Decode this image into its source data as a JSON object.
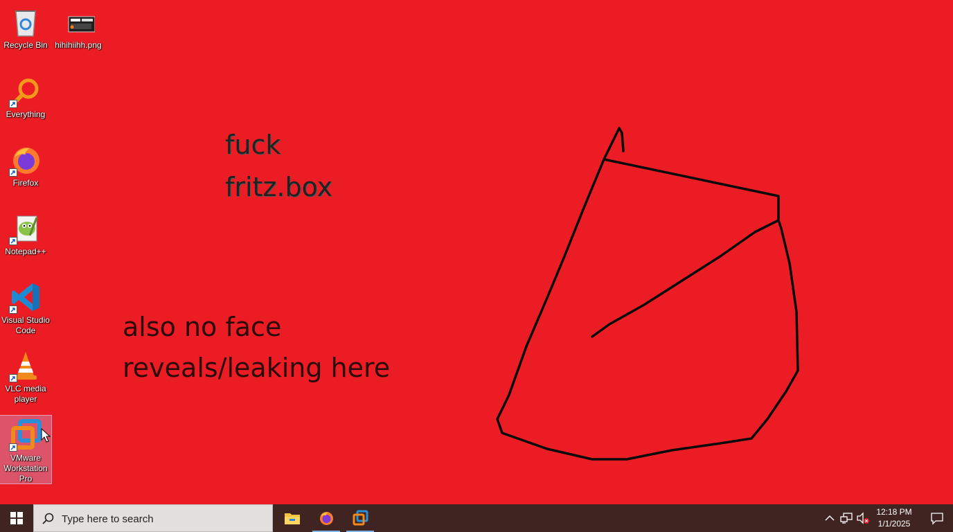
{
  "desktop": {
    "wallpaper_color": "#ec1c24",
    "texts": [
      "fuck",
      "fritz.box",
      "also no face",
      "reveals/leaking here"
    ],
    "icons": [
      {
        "label": "Recycle Bin",
        "icon": "recycle-bin-icon"
      },
      {
        "label": "hihihiihh.png",
        "icon": "image-file-icon"
      },
      {
        "label": "Everything",
        "icon": "everything-search-icon"
      },
      {
        "label": "Firefox",
        "icon": "firefox-icon"
      },
      {
        "label": "Notepad++",
        "icon": "notepad-plus-plus-icon"
      },
      {
        "label": "Visual Studio Code",
        "icon": "vscode-icon"
      },
      {
        "label": "VLC media player",
        "icon": "vlc-icon"
      },
      {
        "label": "VMware Workstation Pro",
        "icon": "vmware-icon"
      }
    ],
    "selected_icon": "VMware Workstation Pro"
  },
  "taskbar": {
    "search_placeholder": "Type here to search",
    "pinned": [
      "file-explorer-icon",
      "firefox-icon",
      "vmware-icon"
    ],
    "tray_icons": [
      "chevron-up-icon",
      "network-icon",
      "volume-muted-icon"
    ],
    "time": "12:18 PM",
    "date": "1/1/2025",
    "accent_color": "#3f2422"
  }
}
